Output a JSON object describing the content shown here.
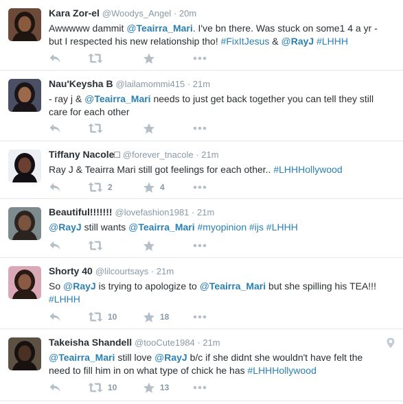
{
  "tweets": [
    {
      "fullname": "Kara Zor-el",
      "username": "@Woodys_Angel",
      "time": "20m",
      "text": [
        [
          {
            "t": "text",
            "v": "Awwwww dammit "
          },
          {
            "t": "mention",
            "at": "@",
            "v": "Teairra_Mari"
          },
          {
            "t": "text",
            "v": ". I've bn there. Was stuck on some1 4 a yr -"
          }
        ],
        [
          {
            "t": "text",
            "v": "but I respected his new relationship tho! "
          },
          {
            "t": "hashtag",
            "v": "#FixItJesus"
          },
          {
            "t": "text",
            "v": " & "
          },
          {
            "t": "mention",
            "at": "@",
            "v": "RayJ"
          },
          {
            "t": "text",
            "v": " "
          },
          {
            "t": "hashtag",
            "v": "#LHHH"
          }
        ]
      ],
      "retweets": "",
      "favorites": ""
    },
    {
      "fullname": "Nau'Keysha B",
      "username": "@lailamommi415",
      "time": "21m",
      "text": [
        [
          {
            "t": "text",
            "v": "- ray j & "
          },
          {
            "t": "mention",
            "at": "@",
            "v": "Teairra_Mari"
          },
          {
            "t": "text",
            "v": " needs to just get back together you can tell they still"
          }
        ],
        [
          {
            "t": "text",
            "v": "care for each other"
          }
        ]
      ],
      "retweets": "",
      "favorites": ""
    },
    {
      "fullname": "Tiffany Nacole□",
      "username": "@forever_tnacole",
      "time": "21m",
      "text": [
        [
          {
            "t": "text",
            "v": "Ray J & Teairra Mari still got feelings for each other.. "
          },
          {
            "t": "hashtag",
            "v": "#LHHHollywood"
          }
        ]
      ],
      "retweets": "2",
      "favorites": "4"
    },
    {
      "fullname": "Beautiful!!!!!!!",
      "username": "@lovefashion1981",
      "time": "21m",
      "text": [
        [
          {
            "t": "mention",
            "at": "@",
            "v": "RayJ"
          },
          {
            "t": "text",
            "v": "  still wants "
          },
          {
            "t": "mention",
            "at": "@",
            "v": "Teairra_Mari"
          },
          {
            "t": "text",
            "v": "  "
          },
          {
            "t": "hashtag",
            "v": "#myopinion"
          },
          {
            "t": "text",
            "v": "  "
          },
          {
            "t": "hashtag",
            "v": "#ijs"
          },
          {
            "t": "text",
            "v": " "
          },
          {
            "t": "hashtag",
            "v": "#LHHH"
          }
        ]
      ],
      "retweets": "",
      "favorites": ""
    },
    {
      "fullname": "Shorty 40",
      "username": "@lilcourtsays",
      "time": "21m",
      "text": [
        [
          {
            "t": "text",
            "v": "So "
          },
          {
            "t": "mention",
            "at": "@",
            "v": "RayJ"
          },
          {
            "t": "text",
            "v": " is trying to apologize to "
          },
          {
            "t": "mention",
            "at": "@",
            "v": "Teairra_Mari"
          },
          {
            "t": "text",
            "v": " but she spilling his TEA!!!"
          }
        ],
        [
          {
            "t": "hashtag",
            "v": "#LHHH"
          }
        ]
      ],
      "retweets": "10",
      "favorites": "18"
    },
    {
      "fullname": "Takeisha Shandell",
      "username": "@tooCute1984",
      "time": "21m",
      "text": [
        [
          {
            "t": "mention",
            "at": "@",
            "v": "Teairra_Mari"
          },
          {
            "t": "text",
            "v": "  still love "
          },
          {
            "t": "mention",
            "at": "@",
            "v": "RayJ"
          },
          {
            "t": "text",
            "v": "  b/c if she didnt she wouldn't have felt the"
          }
        ],
        [
          {
            "t": "text",
            "v": "need to fill him in on what type of chick he has "
          },
          {
            "t": "hashtag",
            "v": "#LHHHollywood"
          }
        ]
      ],
      "retweets": "10",
      "favorites": "13",
      "geo_icon": "map-pin-icon"
    }
  ],
  "colors": {
    "link": "#2a7fb0",
    "muted": "#8899a6",
    "icon": "#b5bfc7",
    "divider": "#e1e8ed"
  },
  "icons": [
    "reply-icon",
    "retweet-icon",
    "favorite-icon",
    "more-icon",
    "map-pin-icon"
  ]
}
